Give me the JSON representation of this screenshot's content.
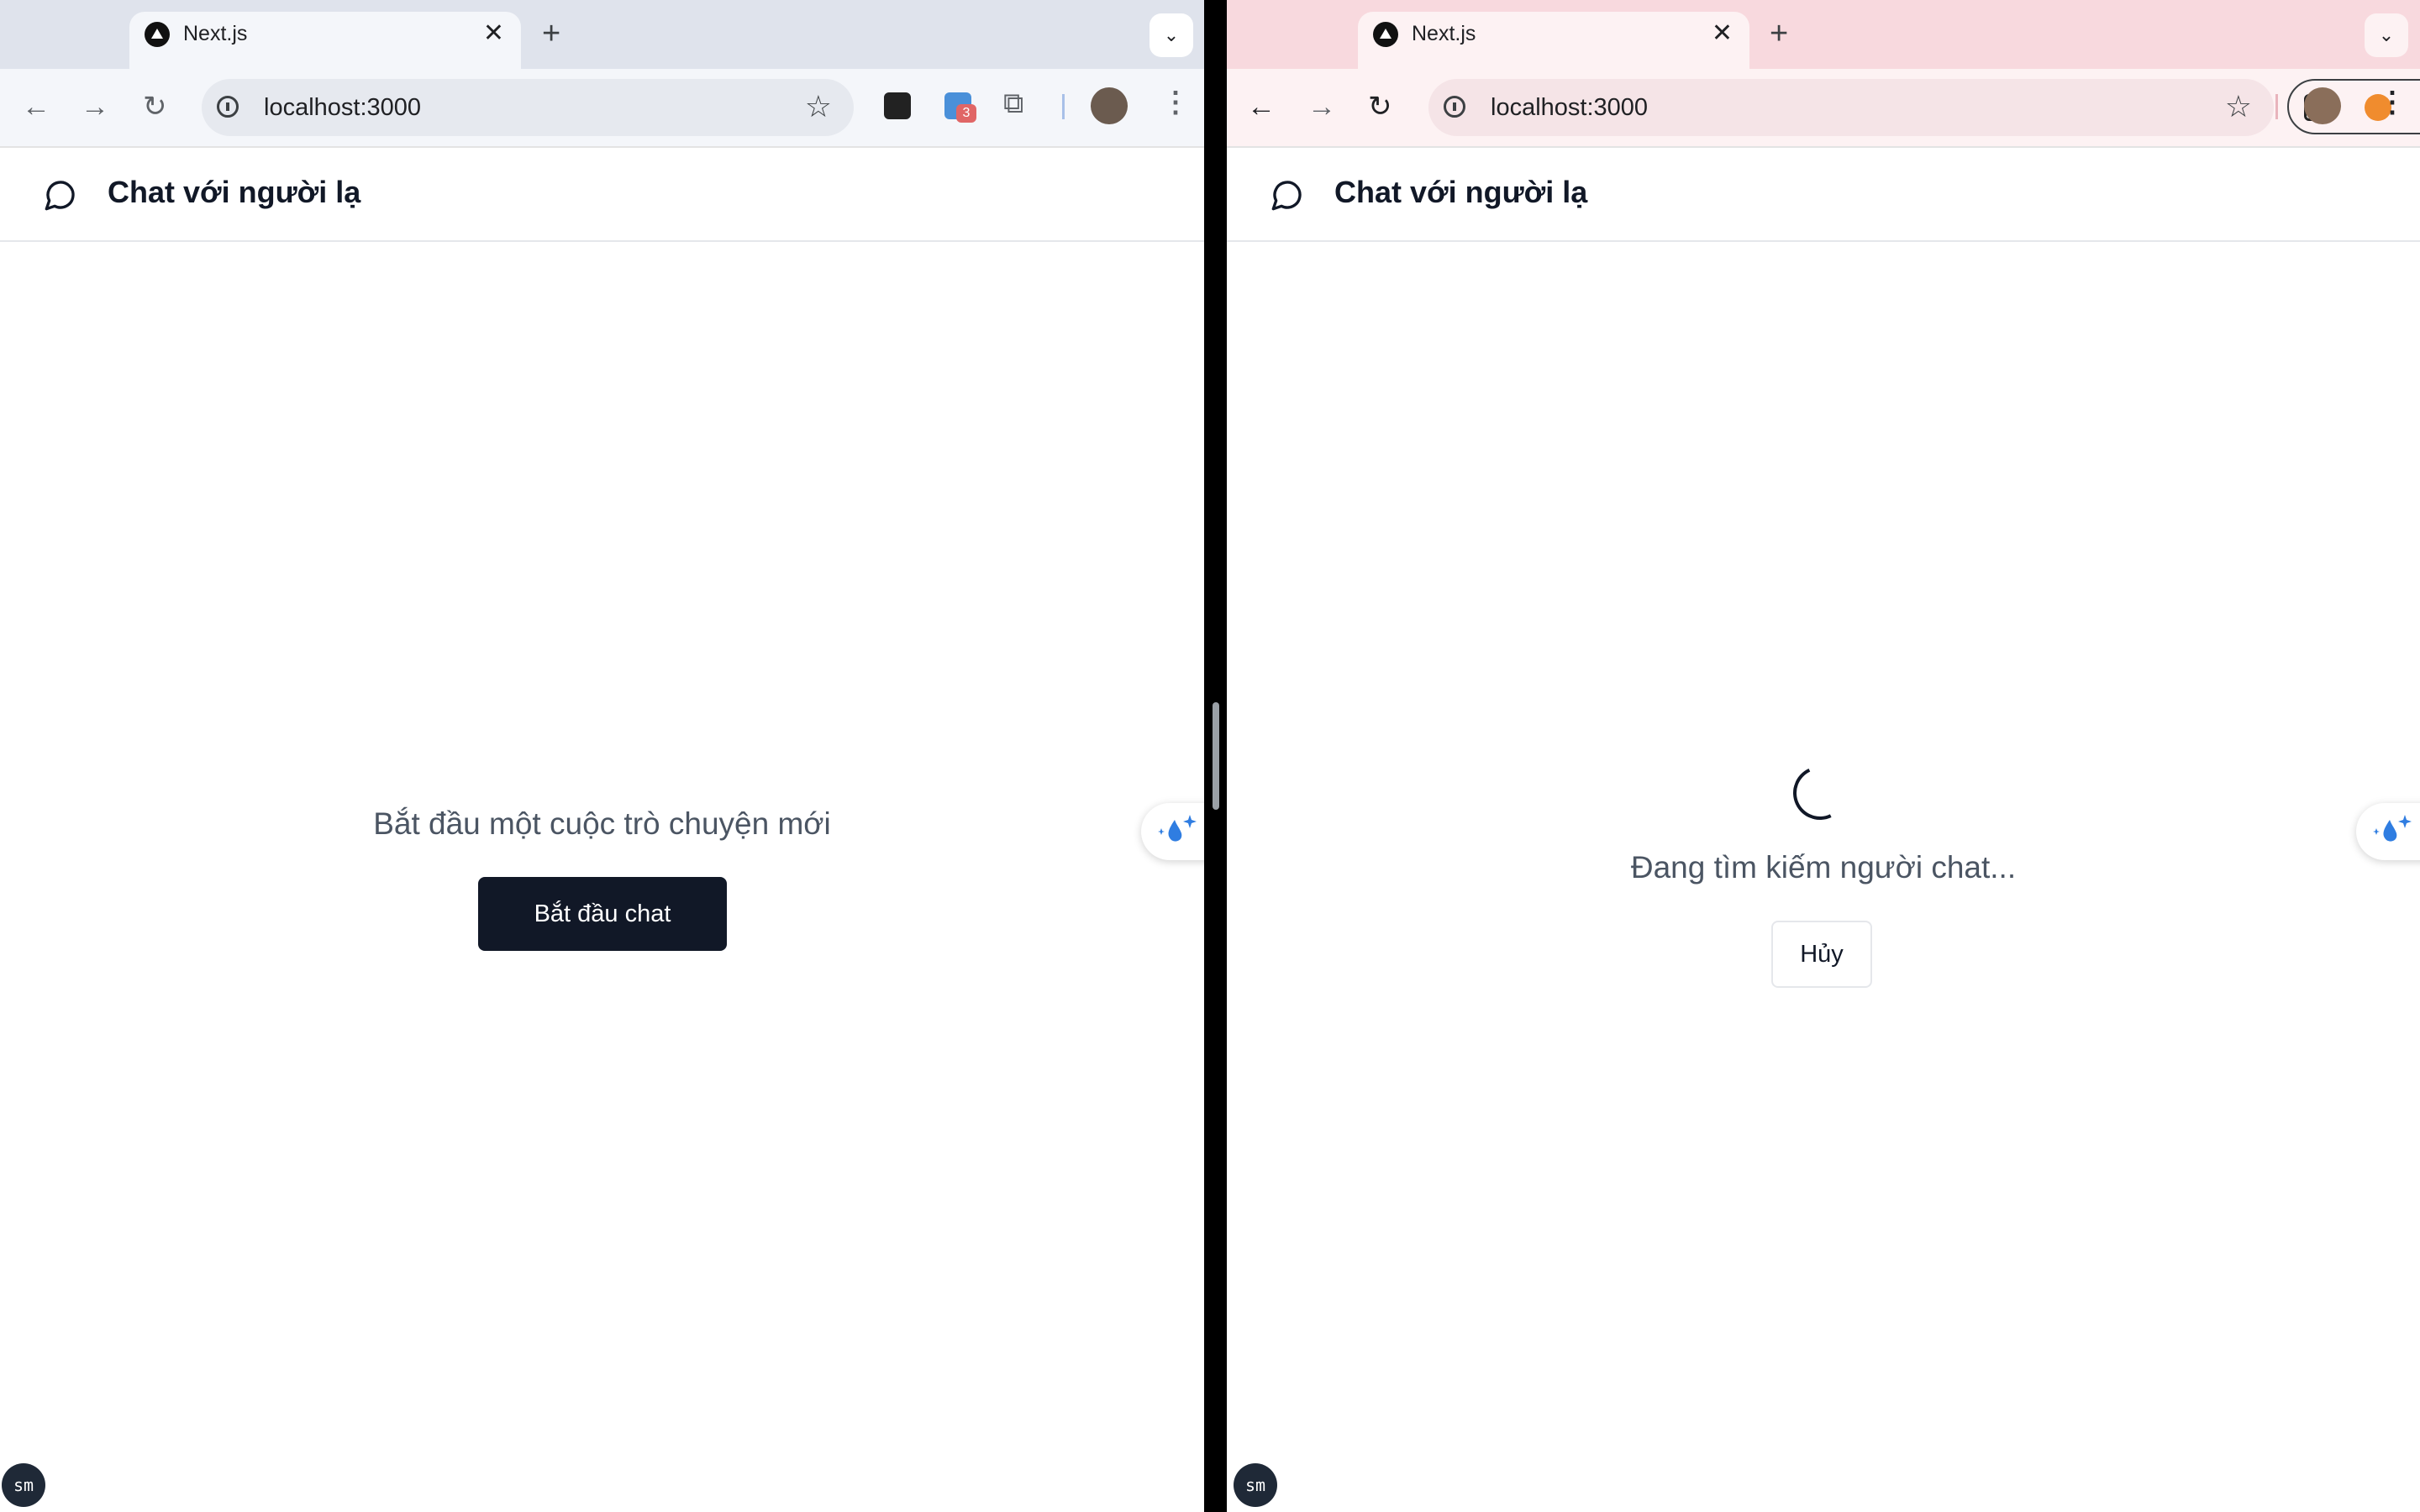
{
  "left_window": {
    "tab": {
      "title": "Next.js",
      "close": "✕"
    },
    "new_tab": "+",
    "tab_menu": "⌄",
    "address": "localhost:3000",
    "app": {
      "title": "Chat với người lạ",
      "prompt": "Bắt đầu một cuộc trò chuyện mới",
      "start_button": "Bắt đầu chat"
    },
    "extension_badge_count": "3",
    "dev_badge": "sm"
  },
  "right_window": {
    "tab": {
      "title": "Next.js",
      "close": "✕"
    },
    "new_tab": "+",
    "tab_menu": "⌄",
    "address": "localhost:3000",
    "app": {
      "title": "Chat với người lạ",
      "status": "Đang tìm kiếm người chat...",
      "cancel_button": "Hủy"
    },
    "dev_badge": "sm"
  },
  "colors": {
    "left_tabstrip": "#dfe3ec",
    "right_tabstrip": "#f8d9de",
    "primary_button": "#111827",
    "text_muted": "#4b5563"
  },
  "icons": [
    "back-arrow-icon",
    "forward-arrow-icon",
    "reload-icon",
    "info-icon",
    "star-icon",
    "puzzle-extension-icon",
    "kebab-menu-icon",
    "chat-bubble-icon",
    "sparkle-drop-icon",
    "spinner-icon"
  ]
}
